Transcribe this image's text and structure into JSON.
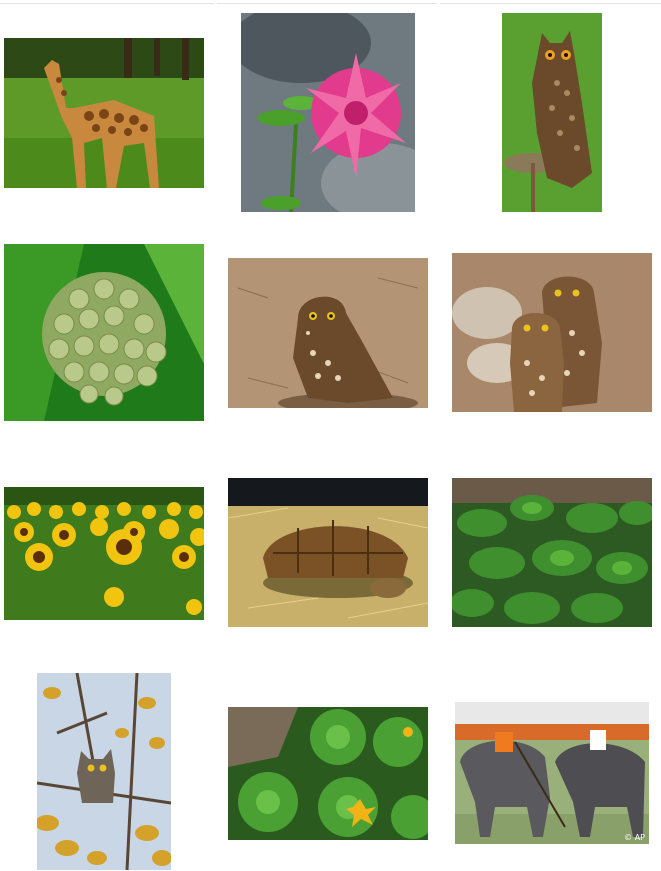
{
  "gallery": {
    "thumbnails": [
      {
        "name": "giraffe",
        "icon": "giraffe-photo"
      },
      {
        "name": "pink-dahlia-flower",
        "icon": "flower-photo"
      },
      {
        "name": "eagle-owl-on-perch",
        "icon": "owl-photo"
      },
      {
        "name": "milkweed-flower-buds",
        "icon": "plant-photo"
      },
      {
        "name": "burrowing-owl",
        "icon": "owl-photo"
      },
      {
        "name": "two-burrowing-owls",
        "icon": "owl-photo"
      },
      {
        "name": "sunflower-field",
        "icon": "flower-photo"
      },
      {
        "name": "tortoise-in-hay",
        "icon": "tortoise-photo"
      },
      {
        "name": "mint-plant",
        "icon": "plant-photo"
      },
      {
        "name": "owl-in-autumn-tree",
        "icon": "owl-photo"
      },
      {
        "name": "squash-plant-leaves",
        "icon": "plant-photo"
      },
      {
        "name": "elephant-polo",
        "icon": "elephant-photo",
        "watermark": "© AP"
      }
    ]
  },
  "colors": {
    "grass": "#4d8a1c",
    "sunflower": "#f1c40f",
    "dahlia": "#e23a8c",
    "owl": "#6b4a2b",
    "sand": "#b39575",
    "leaf": "#3f8f2f"
  }
}
